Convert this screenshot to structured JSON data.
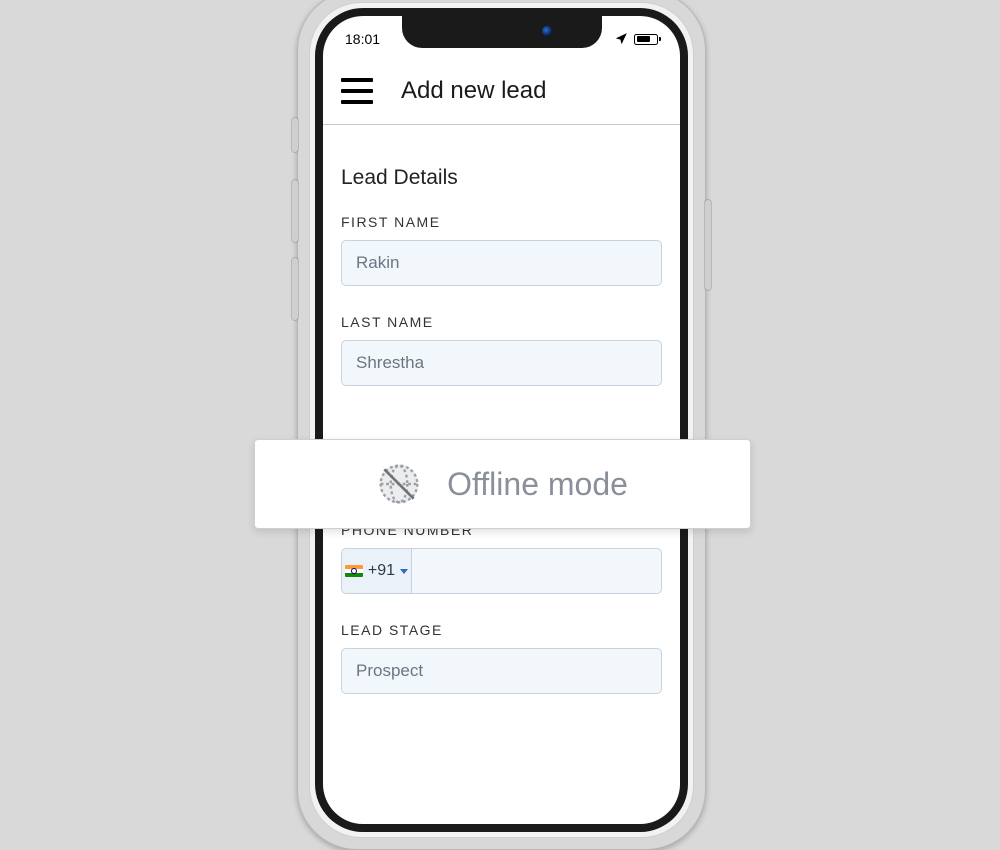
{
  "status": {
    "time": "18:01"
  },
  "header": {
    "title": "Add new lead"
  },
  "form": {
    "section_title": "Lead Details",
    "first_name": {
      "label": "FIRST NAME",
      "value": "Rakin"
    },
    "last_name": {
      "label": "LAST NAME",
      "value": "Shrestha"
    },
    "phone": {
      "label": "PHONE NUMBER",
      "country_code": "+91",
      "value": ""
    },
    "lead_stage": {
      "label": "LEAD STAGE",
      "value": "Prospect"
    }
  },
  "banner": {
    "label": "Offline mode"
  }
}
